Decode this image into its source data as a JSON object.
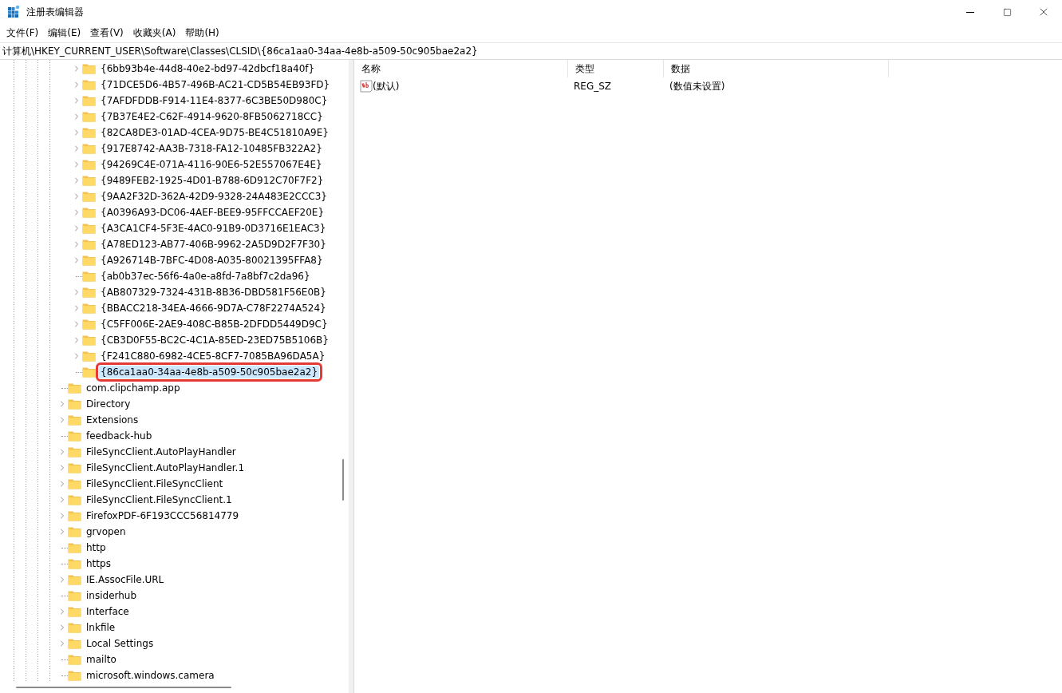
{
  "window": {
    "title": "注册表编辑器"
  },
  "menu": [
    "文件(F)",
    "编辑(E)",
    "查看(V)",
    "收藏夹(A)",
    "帮助(H)"
  ],
  "address": "计算机\\HKEY_CURRENT_USER\\Software\\Classes\\CLSID\\{86ca1aa0-34aa-4e8b-a509-50c905bae2a2}",
  "tree": [
    {
      "children": [
        {
          "label": "{6bb93b4e-44d8-40e2-bd97-42dbcf18a40f}",
          "expandable": true,
          "selected": false
        },
        {
          "label": "{71DCE5D6-4B57-496B-AC21-CD5B54EB93FD}",
          "expandable": true,
          "selected": false
        },
        {
          "label": "{7AFDFDDB-F914-11E4-8377-6C3BE50D980C}",
          "expandable": true,
          "selected": false
        },
        {
          "label": "{7B37E4E2-C62F-4914-9620-8FB5062718CC}",
          "expandable": true,
          "selected": false
        },
        {
          "label": "{82CA8DE3-01AD-4CEA-9D75-BE4C51810A9E}",
          "expandable": true,
          "selected": false
        },
        {
          "label": "{917E8742-AA3B-7318-FA12-10485FB322A2}",
          "expandable": true,
          "selected": false
        },
        {
          "label": "{94269C4E-071A-4116-90E6-52E557067E4E}",
          "expandable": true,
          "selected": false
        },
        {
          "label": "{9489FEB2-1925-4D01-B788-6D912C70F7F2}",
          "expandable": true,
          "selected": false
        },
        {
          "label": "{9AA2F32D-362A-42D9-9328-24A483E2CCC3}",
          "expandable": true,
          "selected": false
        },
        {
          "label": "{A0396A93-DC06-4AEF-BEE9-95FFCCAEF20E}",
          "expandable": true,
          "selected": false
        },
        {
          "label": "{A3CA1CF4-5F3E-4AC0-91B9-0D3716E1EAC3}",
          "expandable": true,
          "selected": false
        },
        {
          "label": "{A78ED123-AB77-406B-9962-2A5D9D2F7F30}",
          "expandable": true,
          "selected": false
        },
        {
          "label": "{A926714B-7BFC-4D08-A035-80021395FFA8}",
          "expandable": true,
          "selected": false
        },
        {
          "label": "{ab0b37ec-56f6-4a0e-a8fd-7a8bf7c2da96}",
          "expandable": false,
          "selected": false
        },
        {
          "label": "{AB807329-7324-431B-8B36-DBD581F56E0B}",
          "expandable": true,
          "selected": false
        },
        {
          "label": "{BBACC218-34EA-4666-9D7A-C78F2274A524}",
          "expandable": true,
          "selected": false
        },
        {
          "label": "{C5FF006E-2AE9-408C-B85B-2DFDD5449D9C}",
          "expandable": true,
          "selected": false
        },
        {
          "label": "{CB3D0F55-BC2C-4C1A-85ED-23ED75B5106B}",
          "expandable": true,
          "selected": false
        },
        {
          "label": "{F241C880-6982-4CE5-8CF7-7085BA96DA5A}",
          "expandable": true,
          "selected": false
        },
        {
          "label": "{86ca1aa0-34aa-4e8b-a509-50c905bae2a2}",
          "expandable": false,
          "selected": true
        }
      ]
    },
    {
      "label": "com.clipchamp.app",
      "expandable": false,
      "selected": false
    },
    {
      "label": "Directory",
      "expandable": true,
      "selected": false
    },
    {
      "label": "Extensions",
      "expandable": true,
      "selected": false
    },
    {
      "label": "feedback-hub",
      "expandable": false,
      "selected": false
    },
    {
      "label": "FileSyncClient.AutoPlayHandler",
      "expandable": true,
      "selected": false
    },
    {
      "label": "FileSyncClient.AutoPlayHandler.1",
      "expandable": true,
      "selected": false
    },
    {
      "label": "FileSyncClient.FileSyncClient",
      "expandable": true,
      "selected": false
    },
    {
      "label": "FileSyncClient.FileSyncClient.1",
      "expandable": true,
      "selected": false
    },
    {
      "label": "FirefoxPDF-6F193CCC56814779",
      "expandable": true,
      "selected": false
    },
    {
      "label": "grvopen",
      "expandable": true,
      "selected": false
    },
    {
      "label": "http",
      "expandable": false,
      "selected": false
    },
    {
      "label": "https",
      "expandable": false,
      "selected": false
    },
    {
      "label": "IE.AssocFile.URL",
      "expandable": true,
      "selected": false
    },
    {
      "label": "insiderhub",
      "expandable": false,
      "selected": false
    },
    {
      "label": "Interface",
      "expandable": true,
      "selected": false
    },
    {
      "label": "lnkfile",
      "expandable": true,
      "selected": false
    },
    {
      "label": "Local Settings",
      "expandable": true,
      "selected": false
    },
    {
      "label": "mailto",
      "expandable": false,
      "selected": false
    },
    {
      "label": "microsoft.windows.camera",
      "expandable": false,
      "selected": false
    }
  ],
  "values": {
    "columns": [
      "名称",
      "类型",
      "数据"
    ],
    "rows": [
      {
        "name": "(默认)",
        "type": "REG_SZ",
        "data": "(数值未设置)"
      }
    ]
  }
}
